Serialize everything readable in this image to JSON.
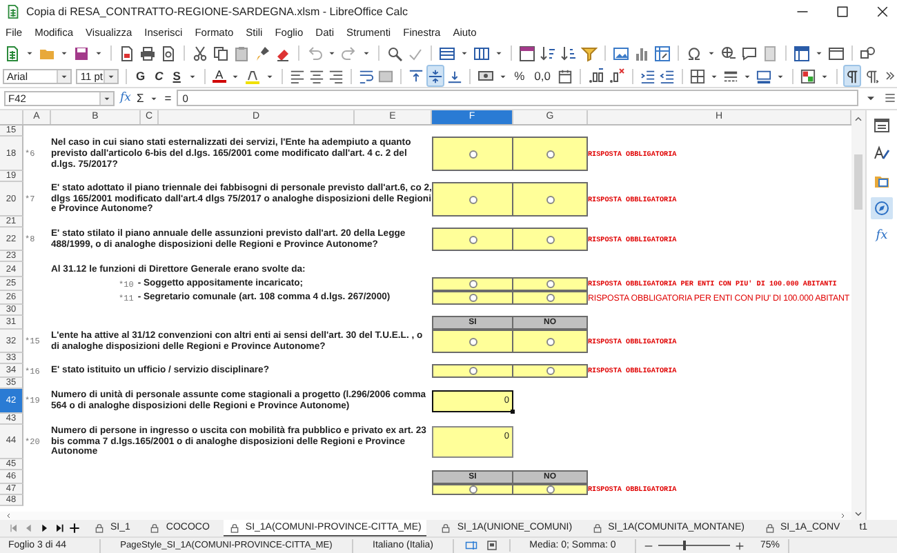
{
  "window": {
    "title": "Copia di RESA_CONTRATTO-REGIONE-SARDEGNA.xlsm - LibreOffice Calc"
  },
  "menu": [
    "File",
    "Modifica",
    "Visualizza",
    "Inserisci",
    "Formato",
    "Stili",
    "Foglio",
    "Dati",
    "Strumenti",
    "Finestra",
    "Aiuto"
  ],
  "format_bar": {
    "font_name": "Arial",
    "font_size": "11 pt",
    "style_buttons": [
      "G",
      "C",
      "S"
    ],
    "font_color": "A",
    "percent": "%",
    "thousands": "0,0",
    "vertical_align": [
      {
        "kind": "top",
        "on": false
      },
      {
        "kind": "middle",
        "on": true
      },
      {
        "kind": "bottom",
        "on": false
      }
    ],
    "direction": [
      {
        "kind": "left_to_right",
        "on": true
      },
      {
        "kind": "right_to_left",
        "on": false
      }
    ]
  },
  "formula_bar": {
    "cell": "F42",
    "wizard": "fx",
    "sum": "Σ",
    "equals": "=",
    "value": "0"
  },
  "columns": [
    {
      "label": "A",
      "selected": false
    },
    {
      "label": "B",
      "selected": false
    },
    {
      "label": "C",
      "selected": false
    },
    {
      "label": "D",
      "selected": false
    },
    {
      "label": "E",
      "selected": false
    },
    {
      "label": "F",
      "selected": true
    },
    {
      "label": "G",
      "selected": false
    },
    {
      "label": "H",
      "selected": false
    }
  ],
  "rows": [
    {
      "num": "15",
      "kind": "spacer",
      "selected": false
    },
    {
      "num": "18",
      "kind": "question",
      "selected": false,
      "marker": "*6",
      "text": "Nel caso in cui siano stati esternalizzati dei servizi, l'Ente ha adempiuto a quanto previsto dall'articolo 6-bis del d.lgs. 165/2001 come modificato dall'art. 4 c. 2 del d.lgs. 75/2017?",
      "answers": [
        {
          "selected": false
        },
        {
          "selected": false
        }
      ],
      "note": {
        "kind": "small",
        "text": "RISPOSTA OBBLIGATORIA"
      }
    },
    {
      "num": "19",
      "kind": "spacer",
      "selected": false
    },
    {
      "num": "20",
      "kind": "question",
      "selected": false,
      "marker": "*7",
      "text": "E' stato adottato il piano triennale dei fabbisogni di personale previsto dall'art.6, co 2, dlgs 165/2001 modificato dall'art.4 dlgs 75/2017 o analoghe disposizioni delle Regioni e Province Autonome?",
      "answers": [
        {
          "selected": false
        },
        {
          "selected": false
        }
      ],
      "note": {
        "kind": "small",
        "text": "RISPOSTA OBBLIGATORIA"
      }
    },
    {
      "num": "21",
      "kind": "spacer",
      "selected": false
    },
    {
      "num": "22",
      "kind": "question",
      "selected": false,
      "marker": "*8",
      "text": "E' stato stilato il piano annuale delle assunzioni previsto dall'art. 20 della Legge 488/1999, o di analoghe disposizioni delle Regioni e Province Autonome?",
      "answers": [
        {
          "selected": false
        },
        {
          "selected": false
        }
      ],
      "note": {
        "kind": "small",
        "text": "RISPOSTA OBBLIGATORIA"
      }
    },
    {
      "num": "23",
      "kind": "spacer",
      "selected": false
    },
    {
      "num": "24",
      "kind": "heading",
      "selected": false,
      "text": "Al 31.12 le funzioni di Direttore Generale erano svolte da:"
    },
    {
      "num": "25",
      "kind": "sub",
      "selected": false,
      "marker": "*10",
      "text": "- Soggetto appositamente incaricato;",
      "answers": [
        {
          "selected": false
        },
        {
          "selected": false
        }
      ],
      "note": {
        "kind": "small",
        "text": "RISPOSTA OBBLIGATORIA PER ENTI CON PIU' DI 100.000 ABITANTI"
      }
    },
    {
      "num": "26",
      "kind": "sub",
      "selected": false,
      "marker": "*11",
      "text": "- Segretario comunale (art. 108 comma 4 d.lgs. 267/2000)",
      "answers": [
        {
          "selected": false
        },
        {
          "selected": false
        }
      ],
      "note": {
        "kind": "large",
        "text": "RISPOSTA OBBLIGATORIA PER ENTI CON PIU' DI 100.000 ABITANT"
      }
    },
    {
      "num": "30",
      "kind": "spacer",
      "selected": false
    },
    {
      "num": "31",
      "kind": "header",
      "selected": false,
      "labels": [
        "SI",
        "NO"
      ]
    },
    {
      "num": "32",
      "kind": "question",
      "selected": false,
      "marker": "*15",
      "text": "L'ente ha attive al 31/12 convenzioni con altri enti ai sensi dell'art. 30 del T.U.E.L. , o di analoghe disposizioni delle Regioni e Province Autonome?",
      "answers": [
        {
          "selected": false
        },
        {
          "selected": false
        }
      ],
      "note": {
        "kind": "small",
        "text": "RISPOSTA OBBLIGATORIA"
      }
    },
    {
      "num": "33",
      "kind": "spacer",
      "selected": false
    },
    {
      "num": "34",
      "kind": "question",
      "selected": false,
      "marker": "*16",
      "text": "E' stato istituito un ufficio / servizio disciplinare?",
      "answers": [
        {
          "selected": false
        },
        {
          "selected": false
        }
      ],
      "note": {
        "kind": "small",
        "text": "RISPOSTA OBBLIGATORIA"
      }
    },
    {
      "num": "35",
      "kind": "spacer",
      "selected": false
    },
    {
      "num": "42",
      "kind": "number",
      "selected": true,
      "marker": "*19",
      "text": "Numero di unità di personale assunte come stagionali a progetto (l.296/2006 comma 564 o di analoghe disposizioni delle Regioni e Province Autonome)",
      "value": "0"
    },
    {
      "num": "43",
      "kind": "spacer",
      "selected": false
    },
    {
      "num": "44",
      "kind": "number",
      "selected": false,
      "marker": "*20",
      "text": "Numero di persone in ingresso o uscita con mobilità fra pubblico e privato ex art. 23 bis comma 7 d.lgs.165/2001 o di analoghe disposizioni delle Regioni e Province Autonome",
      "value": "0"
    },
    {
      "num": "45",
      "kind": "spacer",
      "selected": false
    },
    {
      "num": "46",
      "kind": "header",
      "selected": false,
      "labels": [
        "SI",
        "NO"
      ]
    },
    {
      "num": "47",
      "kind": "question",
      "selected": false,
      "answers": [
        {
          "selected": false
        },
        {
          "selected": false
        }
      ],
      "note": {
        "kind": "small",
        "text": "RISPOSTA OBBLIGATORIA"
      }
    },
    {
      "num": "48",
      "kind": "spacer",
      "selected": false
    }
  ],
  "sidebar": [
    {
      "kind": "properties",
      "selected": false
    },
    {
      "kind": "styles",
      "selected": false
    },
    {
      "kind": "gallery",
      "selected": false
    },
    {
      "kind": "navigator",
      "selected": true
    },
    {
      "kind": "functions",
      "selected": false,
      "label": "fx"
    }
  ],
  "sheet_tabs": [
    {
      "label": "SI_1",
      "selected": false,
      "locked": true
    },
    {
      "label": "COCOCO",
      "selected": false,
      "locked": true
    },
    {
      "label": "SI_1A(COMUNI-PROVINCE-CITTA_ME)",
      "selected": true,
      "locked": true
    },
    {
      "label": "SI_1A(UNIONE_COMUNI)",
      "selected": false,
      "locked": true
    },
    {
      "label": "SI_1A(COMUNITA_MONTANE)",
      "selected": false,
      "locked": true
    },
    {
      "label": "SI_1A_CONV",
      "selected": false,
      "locked": true
    },
    {
      "label": "t1",
      "selected": false,
      "locked": false
    }
  ],
  "status_bar": {
    "sheet": "Foglio 3 di 44",
    "page_style": "PageStyle_SI_1A(COMUNI-PROVINCE-CITTA_ME)",
    "language": "Italiano (Italia)",
    "summary": "Media: 0; Somma: 0",
    "zoom": {
      "level": 0.36
    },
    "zoom_percent": "75%"
  }
}
